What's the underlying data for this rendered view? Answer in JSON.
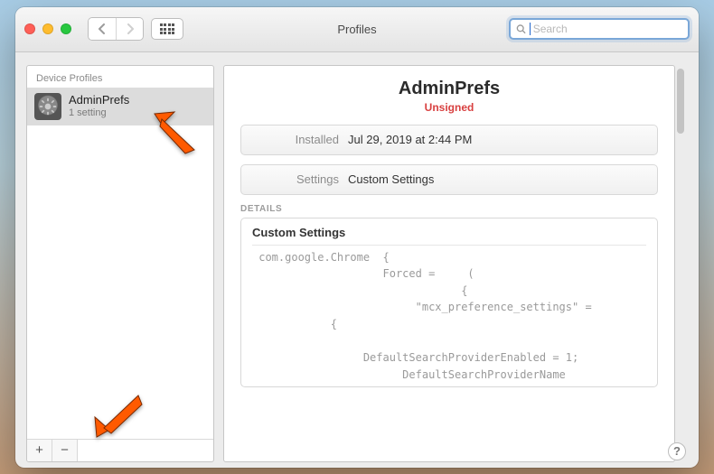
{
  "titlebar": {
    "title": "Profiles",
    "search_placeholder": "Search"
  },
  "sidebar": {
    "header": "Device Profiles",
    "item": {
      "name": "AdminPrefs",
      "subtitle": "1 setting"
    },
    "add_label": "+",
    "remove_label": "−"
  },
  "main": {
    "title": "AdminPrefs",
    "status": "Unsigned",
    "rows": {
      "installed_key": "Installed",
      "installed_val": "Jul 29, 2019 at 2:44 PM",
      "settings_key": "Settings",
      "settings_val": "Custom Settings"
    },
    "details_label": "DETAILS",
    "details_title": "Custom Settings",
    "code": " com.google.Chrome  {\n                    Forced =     (\n                                {\n                         \"mcx_preference_settings\" =\n            {\n\n                 DefaultSearchProviderEnabled = 1;\n                       DefaultSearchProviderName"
  },
  "help_label": "?"
}
